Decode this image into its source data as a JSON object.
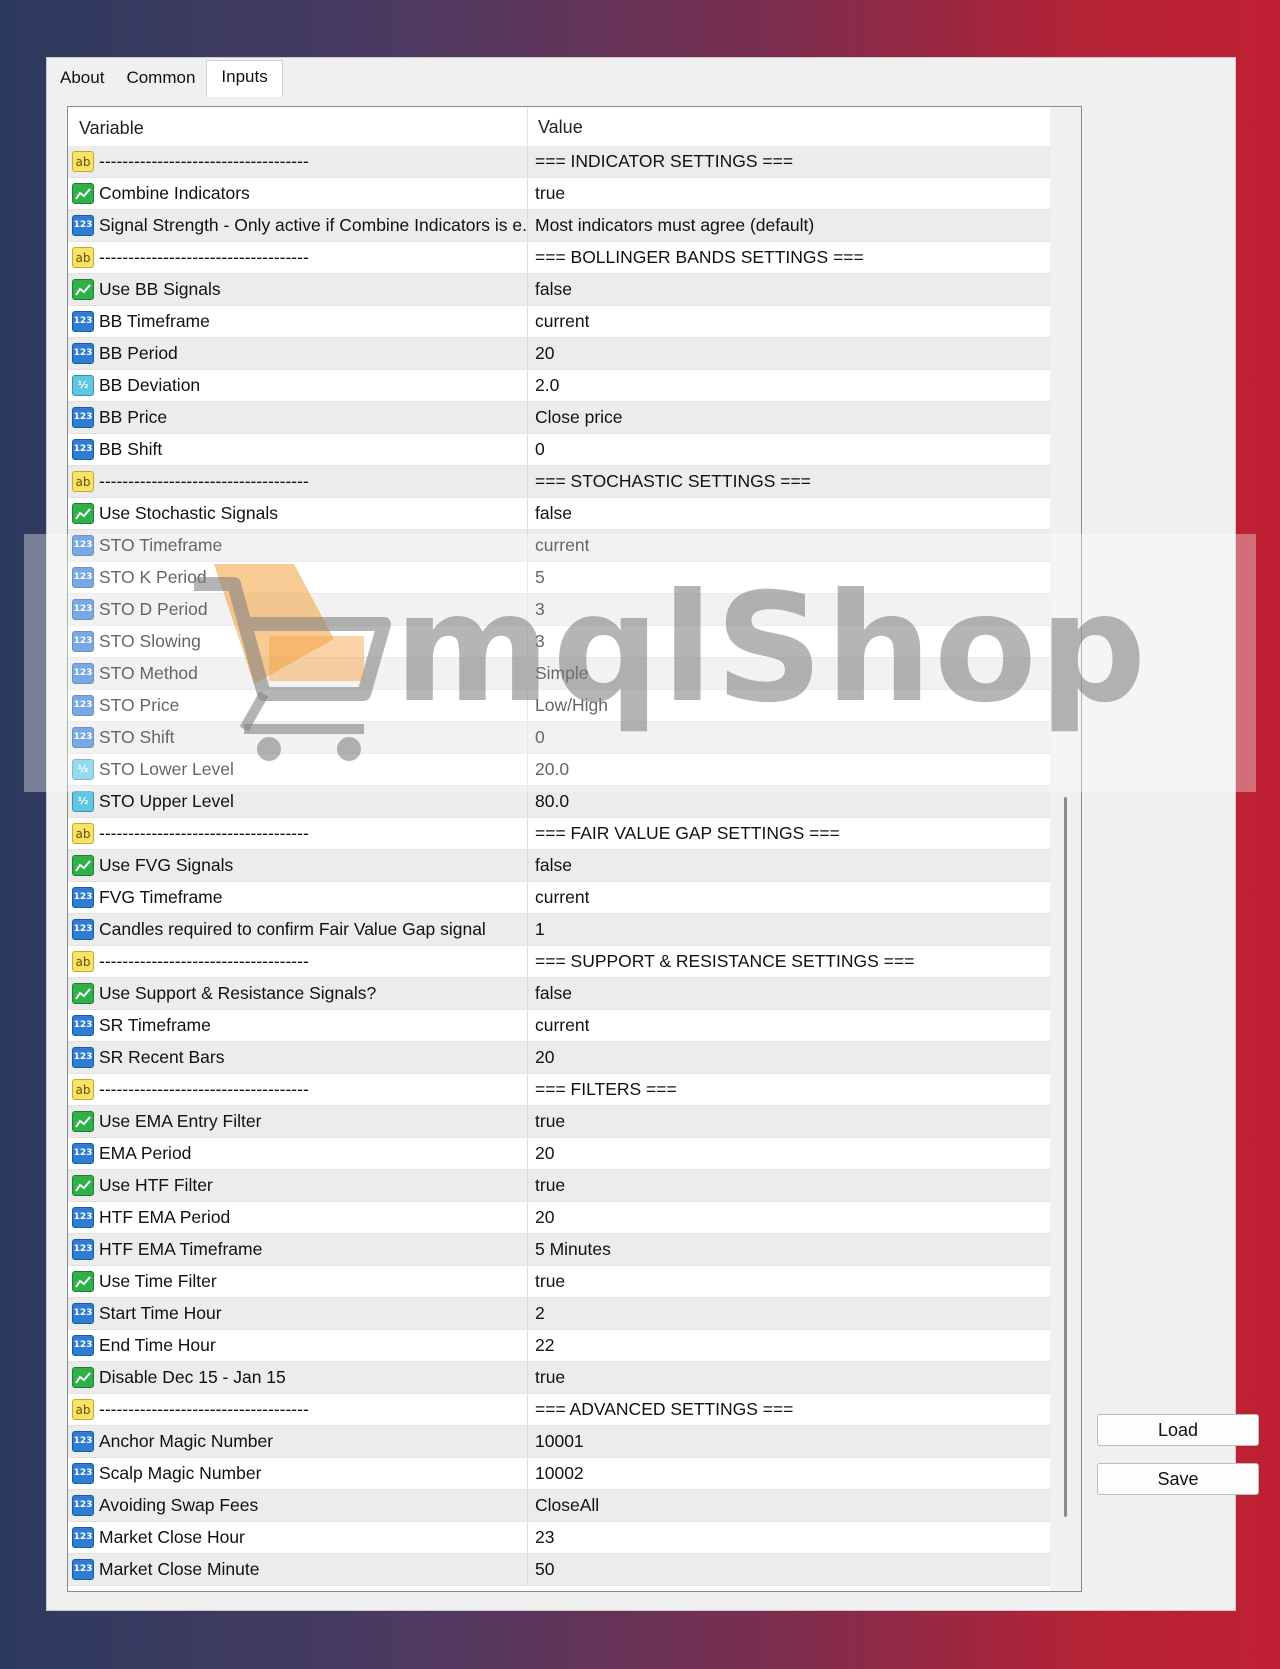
{
  "tabs": [
    {
      "label": "About"
    },
    {
      "label": "Common"
    },
    {
      "label": "Inputs",
      "active": true
    }
  ],
  "table": {
    "headers": {
      "variable": "Variable",
      "value": "Value"
    },
    "rows": [
      {
        "type": "ab",
        "variable": "------------------------------------",
        "value": "=== INDICATOR SETTINGS ==="
      },
      {
        "type": "bool",
        "variable": "Combine Indicators",
        "value": "true"
      },
      {
        "type": "int",
        "variable": "Signal Strength - Only active if Combine Indicators is e...",
        "value": "Most indicators must agree (default)"
      },
      {
        "type": "ab",
        "variable": "------------------------------------",
        "value": "=== BOLLINGER BANDS SETTINGS ==="
      },
      {
        "type": "bool",
        "variable": "Use BB Signals",
        "value": "false"
      },
      {
        "type": "int",
        "variable": "BB Timeframe",
        "value": "current"
      },
      {
        "type": "int",
        "variable": "BB Period",
        "value": "20"
      },
      {
        "type": "dbl",
        "variable": "BB Deviation",
        "value": "2.0"
      },
      {
        "type": "int",
        "variable": "BB Price",
        "value": "Close price"
      },
      {
        "type": "int",
        "variable": "BB Shift",
        "value": "0"
      },
      {
        "type": "ab",
        "variable": "------------------------------------",
        "value": "=== STOCHASTIC SETTINGS ==="
      },
      {
        "type": "bool",
        "variable": "Use Stochastic Signals",
        "value": "false"
      },
      {
        "type": "int",
        "variable": "STO Timeframe",
        "value": "current"
      },
      {
        "type": "int",
        "variable": "STO K Period",
        "value": "5"
      },
      {
        "type": "int",
        "variable": "STO D Period",
        "value": "3"
      },
      {
        "type": "int",
        "variable": "STO Slowing",
        "value": "3"
      },
      {
        "type": "int",
        "variable": "STO Method",
        "value": "Simple"
      },
      {
        "type": "int",
        "variable": "STO Price",
        "value": "Low/High"
      },
      {
        "type": "int",
        "variable": "STO Shift",
        "value": "0"
      },
      {
        "type": "dbl",
        "variable": "STO Lower Level",
        "value": "20.0"
      },
      {
        "type": "dbl",
        "variable": "STO Upper Level",
        "value": "80.0"
      },
      {
        "type": "ab",
        "variable": "------------------------------------",
        "value": "=== FAIR VALUE GAP SETTINGS ==="
      },
      {
        "type": "bool",
        "variable": "Use FVG Signals",
        "value": "false"
      },
      {
        "type": "int",
        "variable": "FVG Timeframe",
        "value": "current"
      },
      {
        "type": "int",
        "variable": "Candles required to confirm Fair Value Gap signal",
        "value": "1"
      },
      {
        "type": "ab",
        "variable": "------------------------------------",
        "value": "=== SUPPORT & RESISTANCE SETTINGS ==="
      },
      {
        "type": "bool",
        "variable": "Use Support & Resistance Signals?",
        "value": "false"
      },
      {
        "type": "int",
        "variable": "SR Timeframe",
        "value": "current"
      },
      {
        "type": "int",
        "variable": "SR Recent Bars",
        "value": "20"
      },
      {
        "type": "ab",
        "variable": "------------------------------------",
        "value": "=== FILTERS ==="
      },
      {
        "type": "bool",
        "variable": "Use EMA Entry Filter",
        "value": "true"
      },
      {
        "type": "int",
        "variable": "EMA Period",
        "value": "20"
      },
      {
        "type": "bool",
        "variable": "Use HTF Filter",
        "value": "true"
      },
      {
        "type": "int",
        "variable": "HTF EMA Period",
        "value": "20"
      },
      {
        "type": "int",
        "variable": "HTF EMA Timeframe",
        "value": "5 Minutes"
      },
      {
        "type": "bool",
        "variable": "Use Time Filter",
        "value": "true"
      },
      {
        "type": "int",
        "variable": "Start Time Hour",
        "value": "2"
      },
      {
        "type": "int",
        "variable": "End Time Hour",
        "value": "22"
      },
      {
        "type": "bool",
        "variable": "Disable Dec 15 - Jan 15",
        "value": "true"
      },
      {
        "type": "ab",
        "variable": "------------------------------------",
        "value": "=== ADVANCED SETTINGS ==="
      },
      {
        "type": "int",
        "variable": "Anchor Magic Number",
        "value": "10001"
      },
      {
        "type": "int",
        "variable": "Scalp Magic Number",
        "value": "10002"
      },
      {
        "type": "int",
        "variable": "Avoiding Swap Fees",
        "value": "CloseAll"
      },
      {
        "type": "int",
        "variable": "Market Close Hour",
        "value": "23"
      },
      {
        "type": "int",
        "variable": "Market Close Minute",
        "value": "50"
      }
    ]
  },
  "icon_labels": {
    "ab": "ab",
    "int": "123",
    "dbl": "½"
  },
  "buttons": {
    "load": "Load",
    "save": "Save"
  },
  "watermark": {
    "text": "mqlShop"
  }
}
